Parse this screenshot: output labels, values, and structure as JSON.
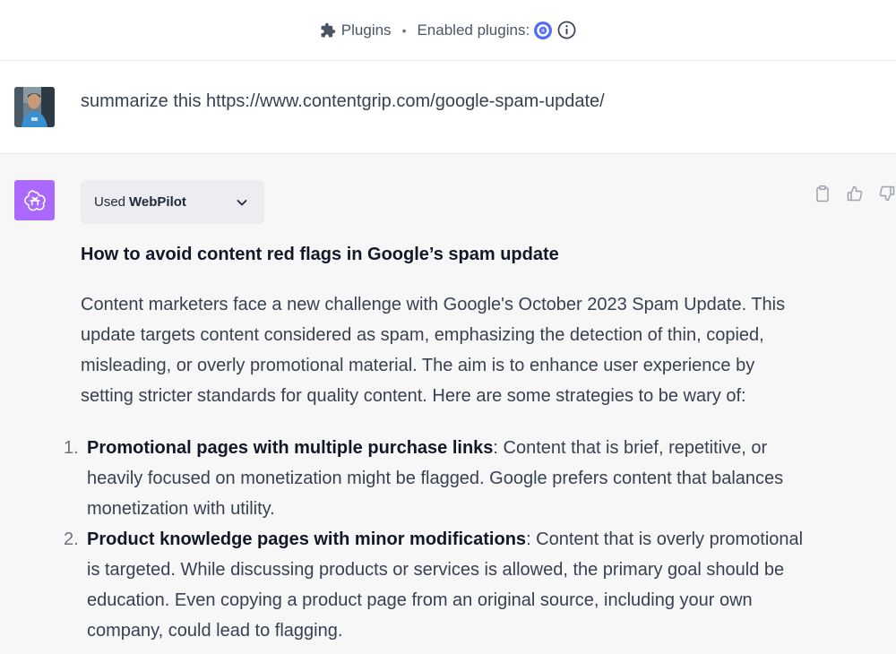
{
  "header": {
    "plugins_label": "Plugins",
    "separator": "•",
    "enabled_label": "Enabled plugins:",
    "plugin_logo_color": "#4f6ef7",
    "icons": [
      "puzzle-icon",
      "webpilot-logo-icon",
      "info-icon"
    ]
  },
  "user_message": {
    "text": "summarize this https://www.contentgrip.com/google-spam-update/"
  },
  "assistant": {
    "logo_color": "#ab68ff",
    "used_plugin": {
      "prefix": "Used",
      "name": "WebPilot"
    },
    "actions": [
      "clipboard-icon",
      "thumbs-up-icon",
      "thumbs-down-icon"
    ],
    "heading": "How to avoid content red flags in Google’s spam update",
    "paragraph": "Content marketers face a new challenge with Google's October 2023 Spam Update. This update targets content considered as spam, emphasizing the detection of thin, copied, misleading, or overly promotional material. The aim is to enhance user experience by setting stricter standards for quality content. Here are some strategies to be wary of:",
    "list": [
      {
        "num": "1.",
        "title": "Promotional pages with multiple purchase links",
        "text": ": Content that is brief, repetitive, or heavily focused on monetization might be flagged. Google prefers content that balances monetization with utility."
      },
      {
        "num": "2.",
        "title": "Product knowledge pages with minor modifications",
        "text": ": Content that is overly promotional is targeted. While discussing products or services is allowed, the primary goal should be education. Even copying a product page from an original source, including your own company, could lead to flagging."
      }
    ]
  }
}
